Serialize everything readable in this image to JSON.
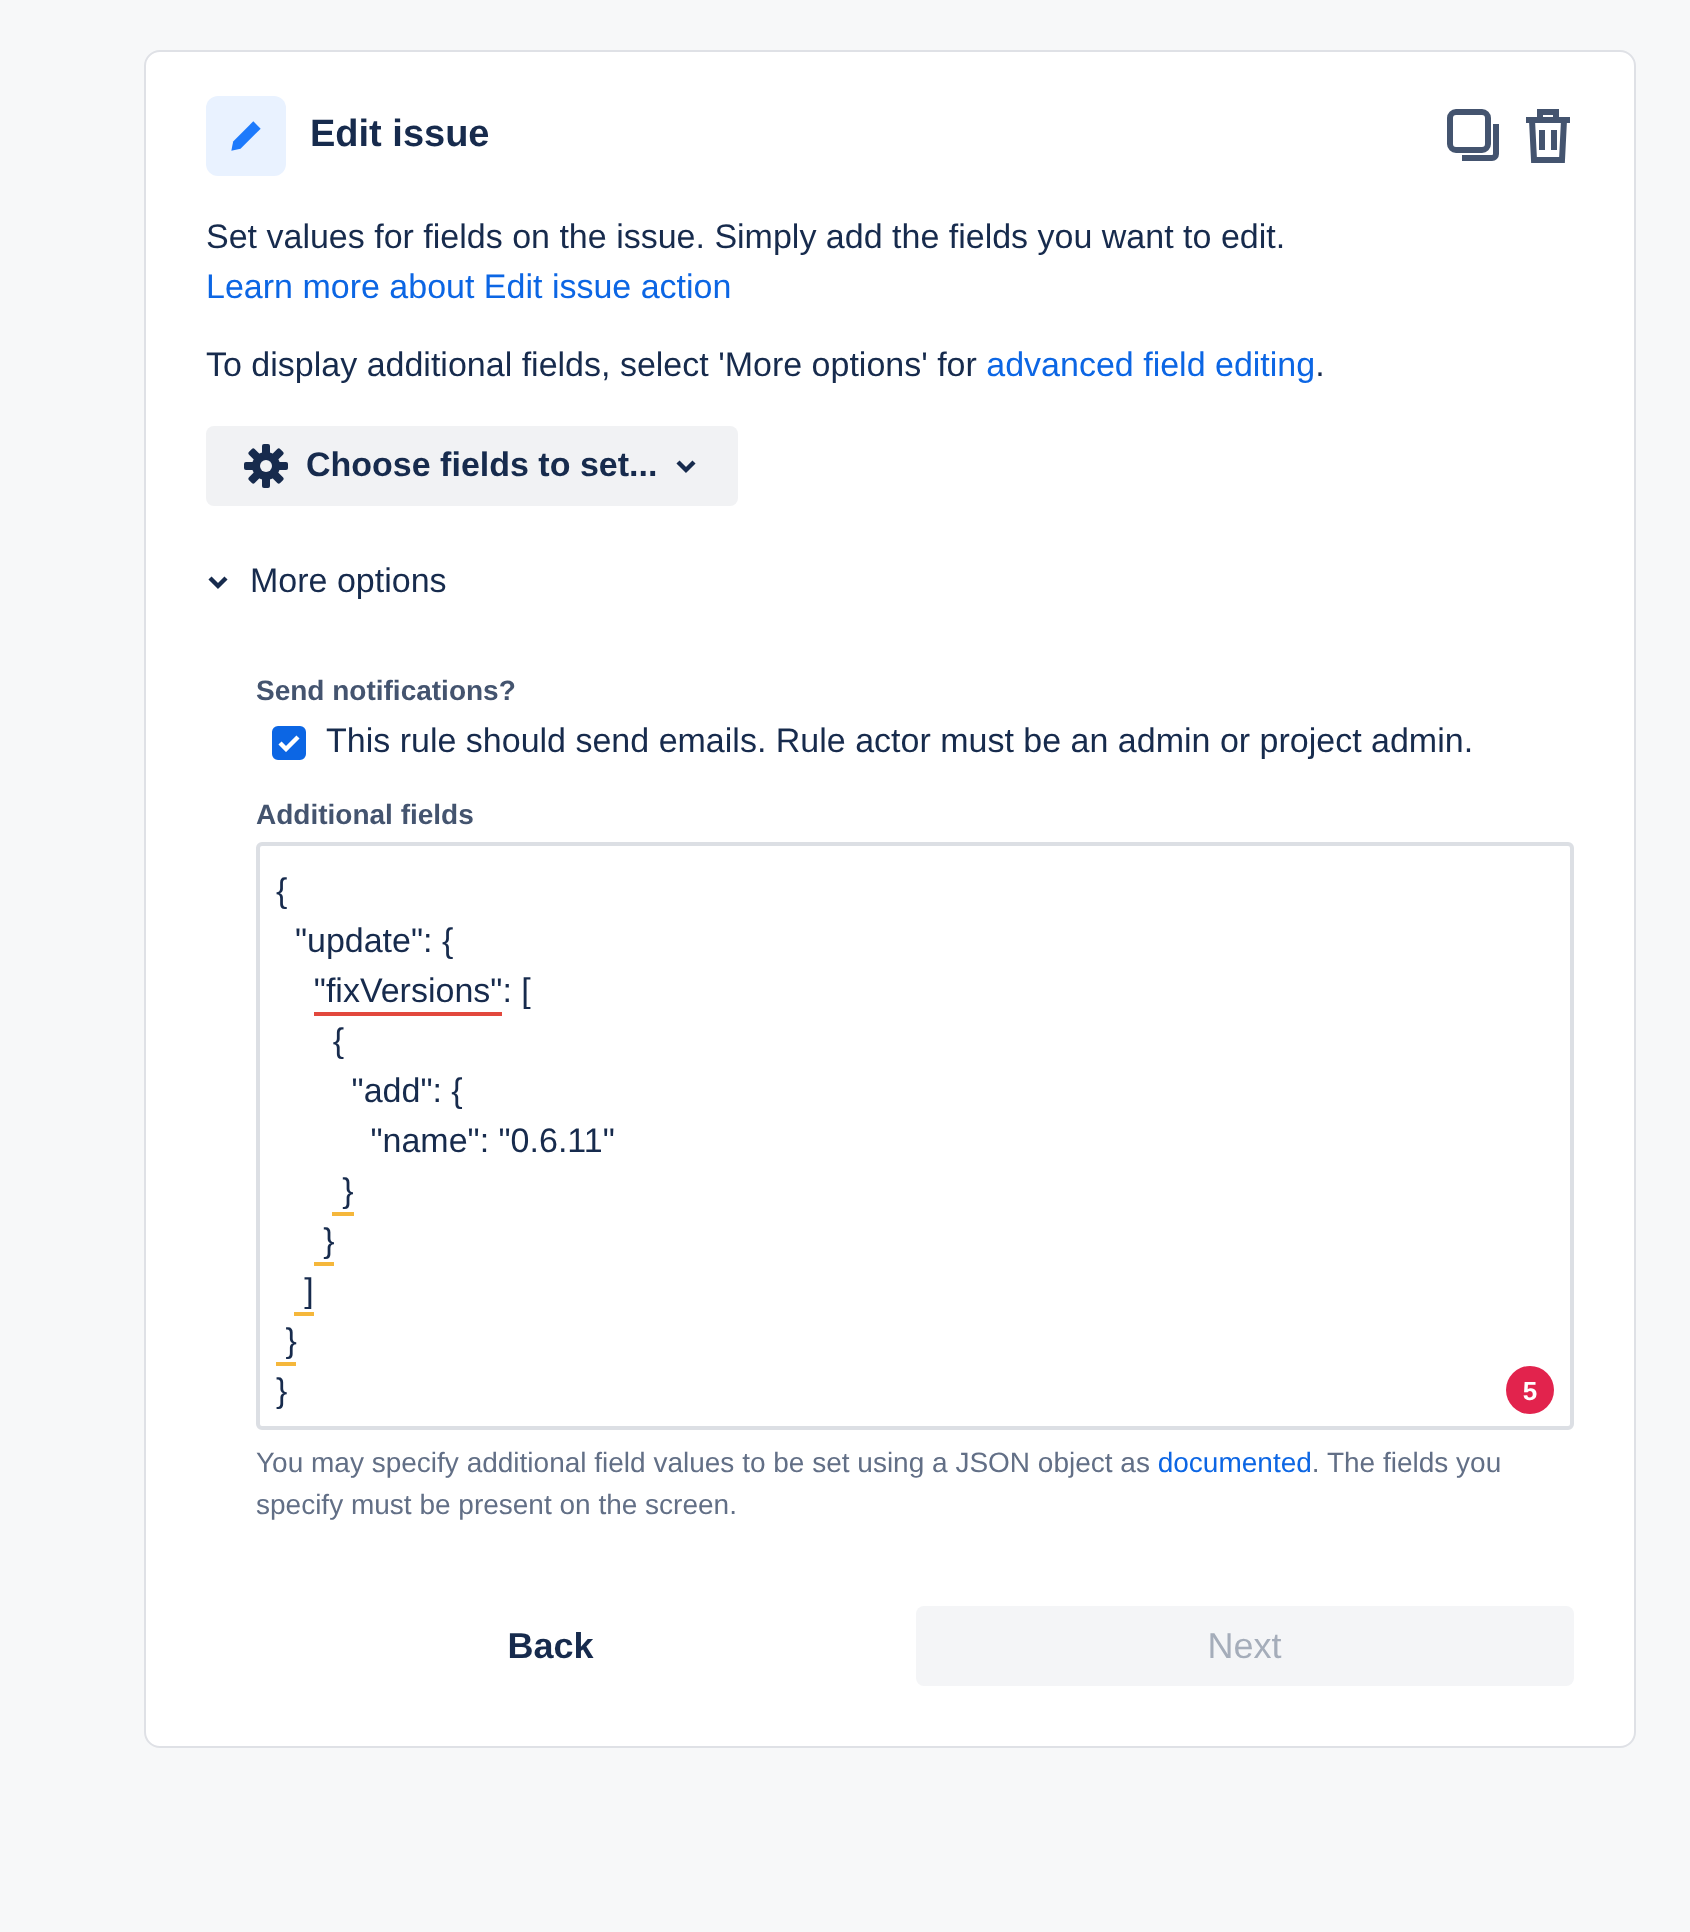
{
  "header": {
    "title": "Edit issue"
  },
  "description": [
    {
      "text": "Set values for fields on the issue. Simply add the fields you want to edit. ",
      "link": "Learn more about Edit issue action"
    }
  ],
  "hint": {
    "text": "To display additional fields, select 'More options' for ",
    "link": "advanced field editing",
    "after": "."
  },
  "choose_button": {
    "label": "Choose fields to set..."
  },
  "more_options": {
    "label": "More options",
    "expanded": true
  },
  "notifications": {
    "label": "Send notifications?",
    "checkbox": {
      "label": "This rule should send emails. Rule actor must be an admin or project admin.",
      "checked": true
    }
  },
  "additional_fields": {
    "label": "Additional fields",
    "lines": [
      [
        {
          "text": "{"
        }
      ],
      [
        {
          "text": "  \"update\": {"
        }
      ],
      [
        {
          "text": "    \"fixVersions\"",
          "error": true
        },
        {
          "text": ": ["
        }
      ],
      [
        {
          "text": "      {"
        }
      ],
      [
        {
          "text": "        \"add\": {"
        }
      ],
      [
        {
          "text": "          \"name\": \"0.6.11\""
        }
      ],
      [
        {
          "text": "       }",
          "warning": true
        }
      ],
      [
        {
          "text": "     }",
          "warning": true
        }
      ],
      [
        {
          "text": "   ]",
          "warning": true
        }
      ],
      [
        {
          "text": " }",
          "warning": true
        }
      ],
      [
        {
          "text": "}"
        }
      ]
    ],
    "error_count": "5",
    "help": {
      "text": "You may specify additional field values to be set using a JSON object as ",
      "link": "documented",
      "after": ". The fields you specify must be present on the screen."
    }
  },
  "buttons": [
    {
      "label": "Back",
      "disabled": false
    },
    {
      "label": "Next",
      "disabled": true
    }
  ]
}
